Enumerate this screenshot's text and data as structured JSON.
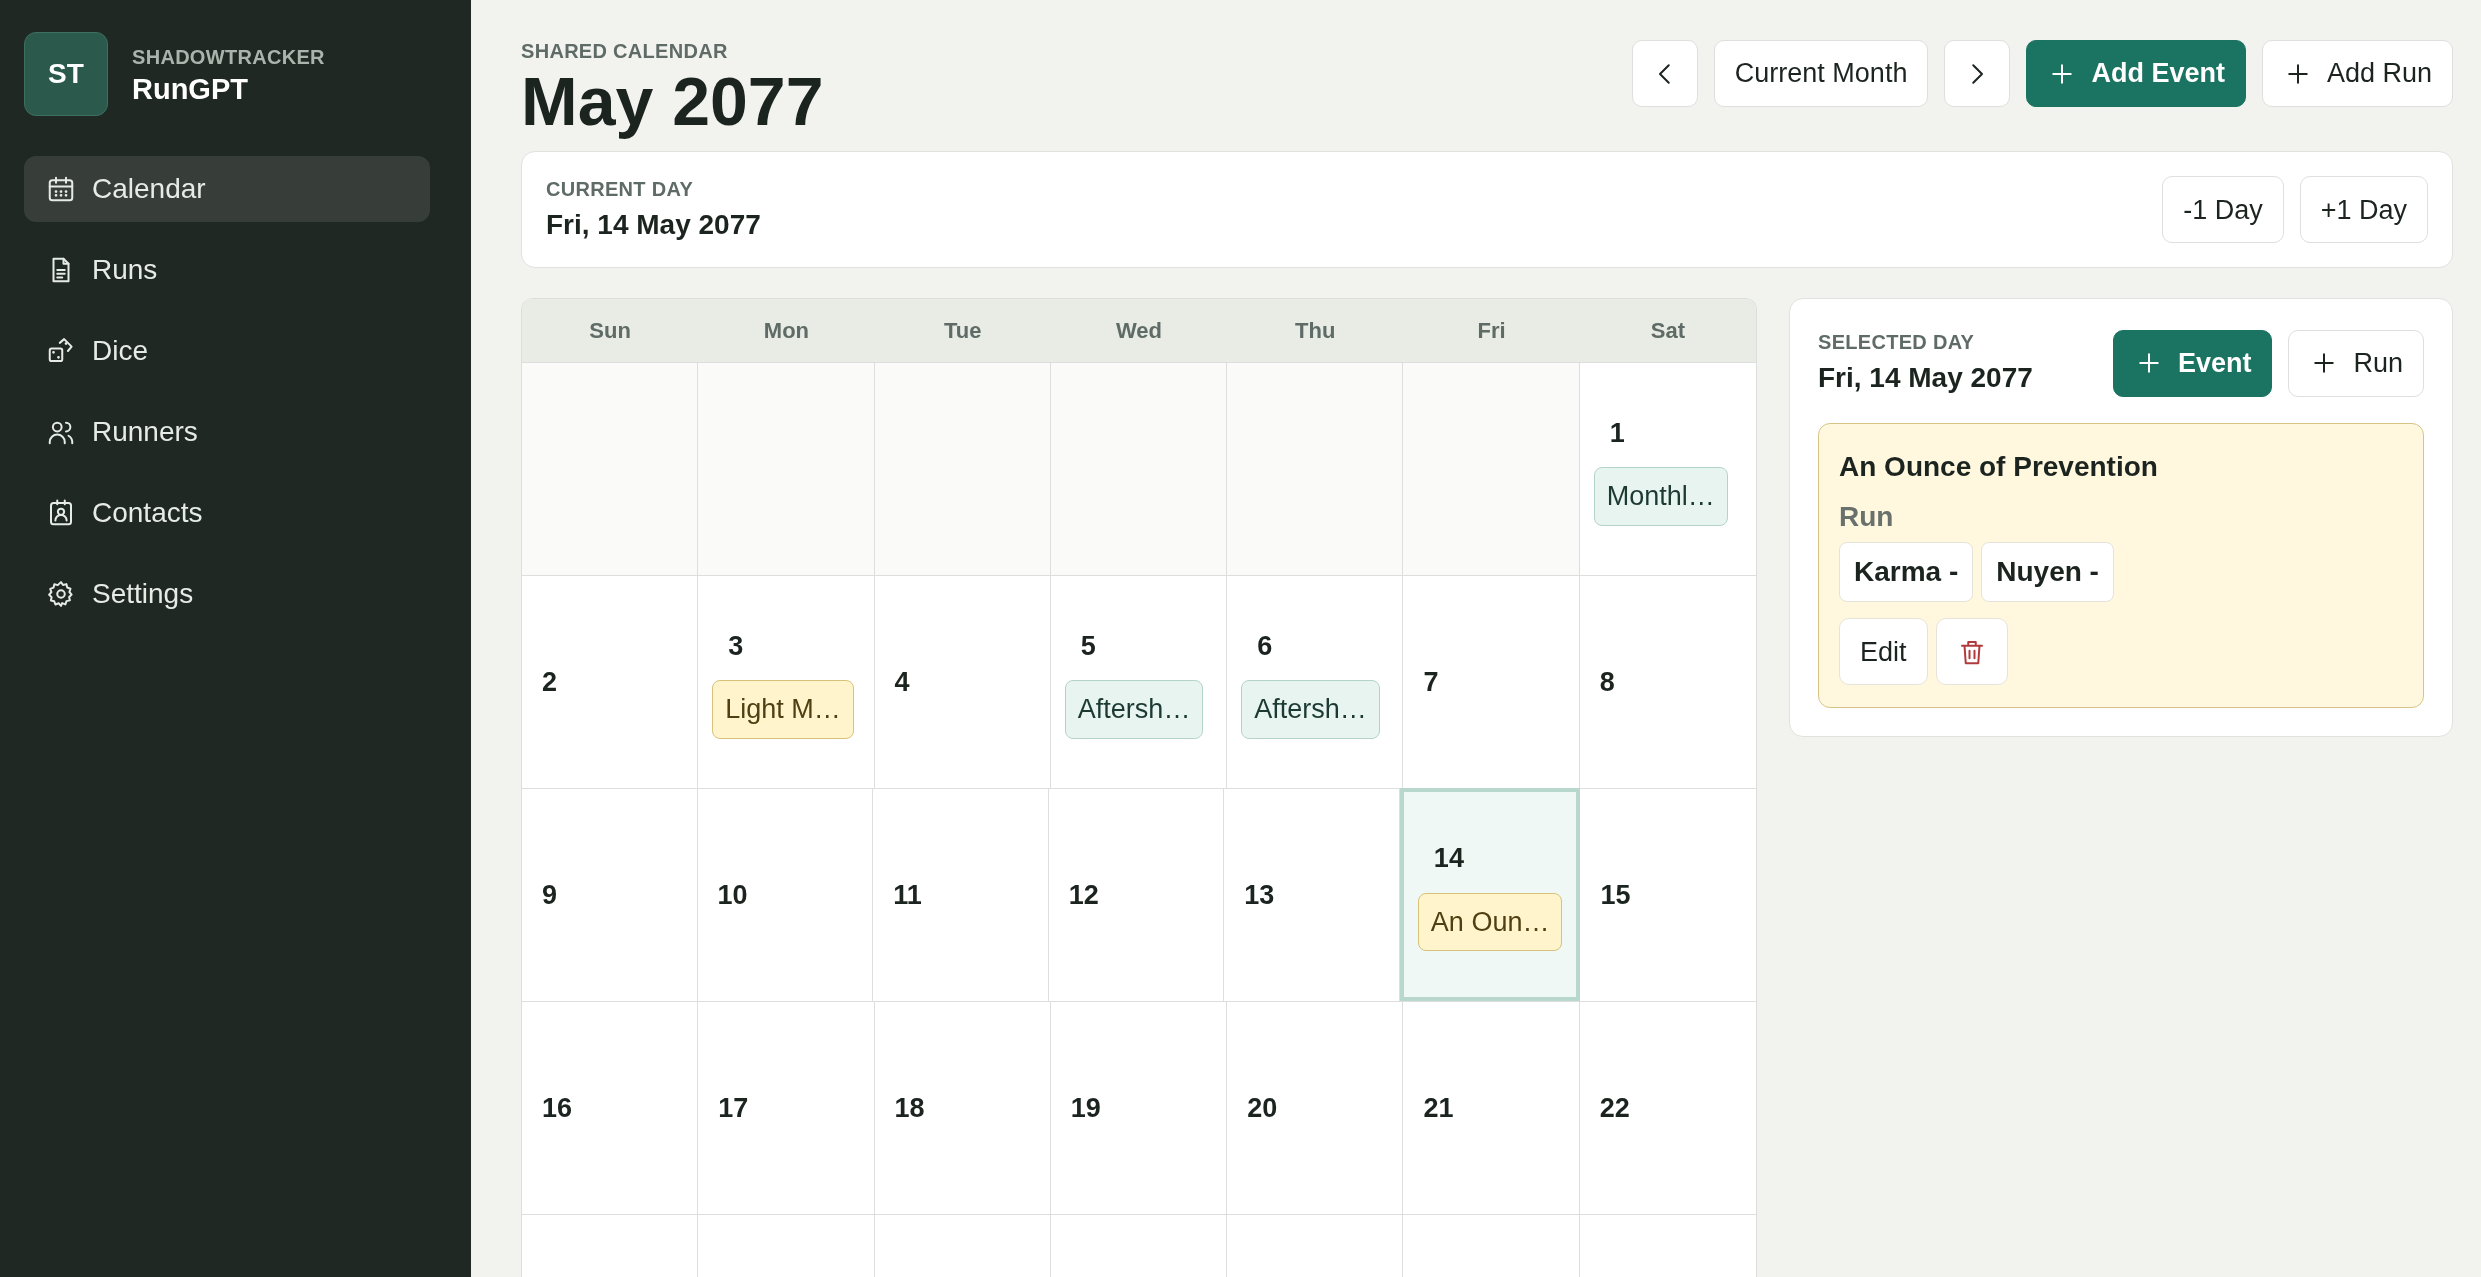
{
  "sidebar": {
    "logo": "ST",
    "eyebrow": "SHADOWTRACKER",
    "app_name": "RunGPT",
    "items": [
      {
        "label": "Calendar",
        "selected": true
      },
      {
        "label": "Runs",
        "selected": false
      },
      {
        "label": "Dice",
        "selected": false
      },
      {
        "label": "Runners",
        "selected": false
      },
      {
        "label": "Contacts",
        "selected": false
      },
      {
        "label": "Settings",
        "selected": false
      }
    ]
  },
  "header": {
    "eyebrow": "SHARED CALENDAR",
    "title": "May 2077",
    "buttons": [
      {
        "kind": "prev"
      },
      {
        "kind": "text",
        "label": "Current Month"
      },
      {
        "kind": "next"
      },
      {
        "kind": "primary",
        "label": "Add Event"
      },
      {
        "kind": "add",
        "label": "Add Run"
      }
    ]
  },
  "current_day": {
    "eyebrow": "CURRENT DAY",
    "date": "Fri, 14 May 2077",
    "buttons": [
      "-1 Day",
      "+1 Day"
    ]
  },
  "calendar": {
    "weekdays": [
      "Sun",
      "Mon",
      "Tue",
      "Wed",
      "Thu",
      "Fri",
      "Sat"
    ],
    "weeks": [
      [
        {
          "in_month": false
        },
        {
          "in_month": false
        },
        {
          "in_month": false
        },
        {
          "in_month": false
        },
        {
          "in_month": false
        },
        {
          "in_month": false
        },
        {
          "in_month": true,
          "day": "1",
          "selected": false,
          "events": [
            {
              "title": "Monthl…",
              "kind": "event"
            }
          ]
        }
      ],
      [
        {
          "in_month": true,
          "day": "2",
          "selected": false
        },
        {
          "in_month": true,
          "day": "3",
          "selected": false,
          "events": [
            {
              "title": "Light M…",
              "kind": "run"
            }
          ]
        },
        {
          "in_month": true,
          "day": "4",
          "selected": false
        },
        {
          "in_month": true,
          "day": "5",
          "selected": false,
          "events": [
            {
              "title": "Aftersh…",
              "kind": "event"
            }
          ]
        },
        {
          "in_month": true,
          "day": "6",
          "selected": false,
          "events": [
            {
              "title": "Aftersh…",
              "kind": "event"
            }
          ]
        },
        {
          "in_month": true,
          "day": "7",
          "selected": false
        },
        {
          "in_month": true,
          "day": "8",
          "selected": false
        }
      ],
      [
        {
          "in_month": true,
          "day": "9",
          "selected": false
        },
        {
          "in_month": true,
          "day": "10",
          "selected": false
        },
        {
          "in_month": true,
          "day": "11",
          "selected": false
        },
        {
          "in_month": true,
          "day": "12",
          "selected": false
        },
        {
          "in_month": true,
          "day": "13",
          "selected": false
        },
        {
          "in_month": true,
          "day": "14",
          "selected": true,
          "events": [
            {
              "title": "An Oun…",
              "kind": "run"
            }
          ]
        },
        {
          "in_month": true,
          "day": "15",
          "selected": false
        }
      ],
      [
        {
          "in_month": true,
          "day": "16",
          "selected": false
        },
        {
          "in_month": true,
          "day": "17",
          "selected": false
        },
        {
          "in_month": true,
          "day": "18",
          "selected": false
        },
        {
          "in_month": true,
          "day": "19",
          "selected": false
        },
        {
          "in_month": true,
          "day": "20",
          "selected": false
        },
        {
          "in_month": true,
          "day": "21",
          "selected": false
        },
        {
          "in_month": true,
          "day": "22",
          "selected": false
        }
      ]
    ]
  },
  "selected_day": {
    "eyebrow": "SELECTED DAY",
    "date": "Fri, 14 May 2077",
    "buttons": [
      {
        "kind": "primary",
        "label": "Event"
      },
      {
        "kind": "add",
        "label": "Run"
      }
    ],
    "events": [
      {
        "title": "An Ounce of Prevention",
        "type": "Run",
        "kind": "run",
        "chips": [
          "Karma -",
          "Nuyen -"
        ],
        "actions": [
          {
            "kind": "text",
            "label": "Edit"
          },
          {
            "kind": "delete"
          }
        ]
      }
    ]
  }
}
